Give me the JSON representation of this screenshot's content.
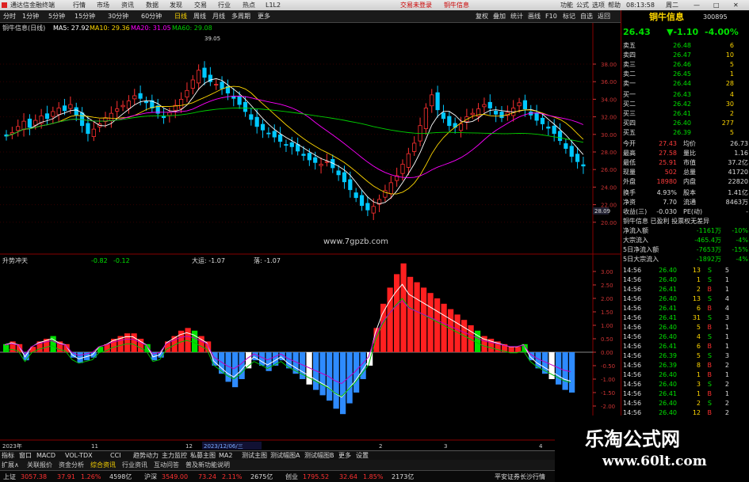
{
  "window": {
    "title": "通达信金融终端",
    "menus": [
      "行情",
      "市场",
      "资讯",
      "数据",
      "发现",
      "交易",
      "行业",
      "热点",
      "L1L2"
    ],
    "center_links": [
      "交易未登录",
      "铜牛信息"
    ],
    "right_menus": [
      "功能",
      "公式",
      "选项",
      "帮助"
    ],
    "clock": "08:13:58",
    "extra": "周二"
  },
  "toolbar": {
    "periods": [
      "分时",
      "1分钟",
      "5分钟",
      "15分钟",
      "30分钟",
      "60分钟",
      "日线",
      "周线",
      "月线",
      "多周期",
      "更多"
    ],
    "right_tools": [
      "复权",
      "叠加",
      "统计",
      "画线",
      "F10",
      "标记",
      "自选",
      "返回"
    ]
  },
  "main_chart": {
    "stock_label": "铜牛信息(日线)",
    "ma": [
      {
        "label": "MA5: 27.92",
        "color": "#ffffff"
      },
      {
        "label": "MA10: 29.36",
        "color": "#ffd700"
      },
      {
        "label": "MA20: 31.05",
        "color": "#ff00ff"
      },
      {
        "label": "MA60: 29.08",
        "color": "#00d000"
      }
    ],
    "high_marker": "39.05",
    "low_marker": "20.88",
    "price_tag": "28.09",
    "watermark": "www.7gpzb.com",
    "yticks": [
      "38.00",
      "36.00",
      "34.00",
      "32.00",
      "30.00",
      "28.00",
      "26.00",
      "24.00",
      "22.00",
      "20.00"
    ]
  },
  "sub_chart": {
    "name": "升势冲天",
    "values": [
      "-0.82",
      "-0.12"
    ],
    "label2": "大运: -1.07",
    "label3": "落: -1.07",
    "yticks": [
      "3.00",
      "2.50",
      "2.00",
      "1.50",
      "1.00",
      "0.50",
      "0.00",
      "-0.50",
      "-1.00",
      "-1.50",
      "-2.00",
      "-2.50",
      "-3.00"
    ]
  },
  "time_axis": {
    "labels": [
      "2023年",
      "11",
      "12",
      "2023/12/06/三",
      "2",
      "3",
      "4"
    ]
  },
  "right_panel": {
    "stock_name": "铜牛信息",
    "code": "300895",
    "price": "26.43",
    "change": "▼-1.10",
    "pct": "-4.00%",
    "sells": [
      {
        "label": "卖五",
        "price": "26.48",
        "vol": "6"
      },
      {
        "label": "卖四",
        "price": "26.47",
        "vol": "10"
      },
      {
        "label": "卖三",
        "price": "26.46",
        "vol": "5"
      },
      {
        "label": "卖二",
        "price": "26.45",
        "vol": "1"
      },
      {
        "label": "卖一",
        "price": "26.44",
        "vol": "28"
      }
    ],
    "buys": [
      {
        "label": "买一",
        "price": "26.43",
        "vol": "4"
      },
      {
        "label": "买二",
        "price": "26.42",
        "vol": "30"
      },
      {
        "label": "买三",
        "price": "26.41",
        "vol": "2"
      },
      {
        "label": "买四",
        "price": "26.40",
        "vol": "277"
      },
      {
        "label": "买五",
        "price": "26.39",
        "vol": "5"
      }
    ],
    "stats": [
      {
        "l1": "今开",
        "v1": "27.43",
        "l2": "均价",
        "v2": "26.73"
      },
      {
        "l1": "最高",
        "v1": "27.58",
        "l2": "量比",
        "v2": "1.16"
      },
      {
        "l1": "最低",
        "v1": "25.91",
        "l2": "市值",
        "v2": "37.2亿"
      },
      {
        "l1": "现量",
        "v1": "502",
        "l2": "总量",
        "v2": "41720"
      },
      {
        "l1": "外盘",
        "v1": "18980",
        "l2": "内盘",
        "v2": "22820"
      }
    ],
    "stats2": [
      {
        "l1": "换手",
        "v1": "4.93%",
        "l2": "股本",
        "v2": "1.41亿"
      },
      {
        "l1": "净资",
        "v1": "7.70",
        "l2": "流通",
        "v2": "8463万"
      },
      {
        "l1": "收益(三)",
        "v1": "-0.030",
        "l2": "PE(动)",
        "v2": "-"
      }
    ],
    "tags": "铜牛信息 已盈利 投票权无差异",
    "flows": [
      {
        "l": "净流入额",
        "v": "-1161万",
        "p": "-10%"
      },
      {
        "l": "大宗流入",
        "v": "-465.4万",
        "p": "-4%"
      },
      {
        "l": "5日净流入额",
        "v": "-7653万",
        "p": "-15%"
      },
      {
        "l": "5日大宗流入",
        "v": "-1892万",
        "p": "-4%"
      }
    ],
    "ticks": [
      {
        "t": "14:56",
        "p": "26.40",
        "v": "13",
        "s": "S",
        "n": "5"
      },
      {
        "t": "14:56",
        "p": "26.40",
        "v": "1",
        "s": "S",
        "n": "1"
      },
      {
        "t": "14:56",
        "p": "26.41",
        "v": "2",
        "s": "B",
        "n": "1"
      },
      {
        "t": "14:56",
        "p": "26.40",
        "v": "13",
        "s": "S",
        "n": "4"
      },
      {
        "t": "14:56",
        "p": "26.41",
        "v": "6",
        "s": "B",
        "n": "4"
      },
      {
        "t": "14:56",
        "p": "26.41",
        "v": "31",
        "s": "S",
        "n": "3"
      },
      {
        "t": "14:56",
        "p": "26.40",
        "v": "5",
        "s": "B",
        "n": "1"
      },
      {
        "t": "14:56",
        "p": "26.40",
        "v": "4",
        "s": "S",
        "n": "1"
      },
      {
        "t": "14:56",
        "p": "26.41",
        "v": "6",
        "s": "B",
        "n": "1"
      },
      {
        "t": "14:56",
        "p": "26.39",
        "v": "5",
        "s": "S",
        "n": "3"
      },
      {
        "t": "14:56",
        "p": "26.39",
        "v": "8",
        "s": "B",
        "n": "2"
      },
      {
        "t": "14:56",
        "p": "26.40",
        "v": "1",
        "s": "B",
        "n": "1"
      },
      {
        "t": "14:56",
        "p": "26.40",
        "v": "3",
        "s": "S",
        "n": "2"
      },
      {
        "t": "14:56",
        "p": "26.41",
        "v": "1",
        "s": "B",
        "n": "1"
      },
      {
        "t": "14:56",
        "p": "26.40",
        "v": "2",
        "s": "S",
        "n": "2"
      },
      {
        "t": "14:56",
        "p": "26.40",
        "v": "12",
        "s": "B",
        "n": "2"
      },
      {
        "t": "14:56",
        "p": "26.40",
        "v": "3",
        "s": "S",
        "n": "1"
      },
      {
        "t": "14:56",
        "p": "26.40",
        "v": "4",
        "s": "S",
        "n": "2"
      }
    ]
  },
  "bottom_tabs": [
    "指标",
    "窗口",
    "MACD",
    "VOL-TDX",
    "CCI",
    "趋势动力",
    "主力监控",
    "私募主图",
    "MA2",
    "测试主图",
    "测试幅图A",
    "测试幅图B",
    "更多",
    "设置"
  ],
  "bottom_tabs2": [
    "扩展∧",
    "关联报价",
    "资金分析",
    "综合资讯",
    "行业资讯",
    "互动问答",
    "普及新功能说明"
  ],
  "status": [
    {
      "label": "上证",
      "v1": "3057.38",
      "v2": "37.91",
      "v3": "1.26%",
      "v4": "4598亿"
    },
    {
      "label": "沪深",
      "v1": "3549.00",
      "v2": "73.24",
      "v3": "2.11%",
      "v4": "2675亿"
    },
    {
      "label": "创业",
      "v1": "1795.52",
      "v2": "32.64",
      "v3": "1.85%",
      "v4": "2173亿"
    }
  ],
  "broker": "平安证券长沙行情",
  "ad": {
    "title": "乐淘公式网",
    "url": "www.60lt.com"
  },
  "colors": {
    "up": "#ff3030",
    "down": "#00c8ff",
    "accent": "#ffd700",
    "bg": "#000000"
  }
}
